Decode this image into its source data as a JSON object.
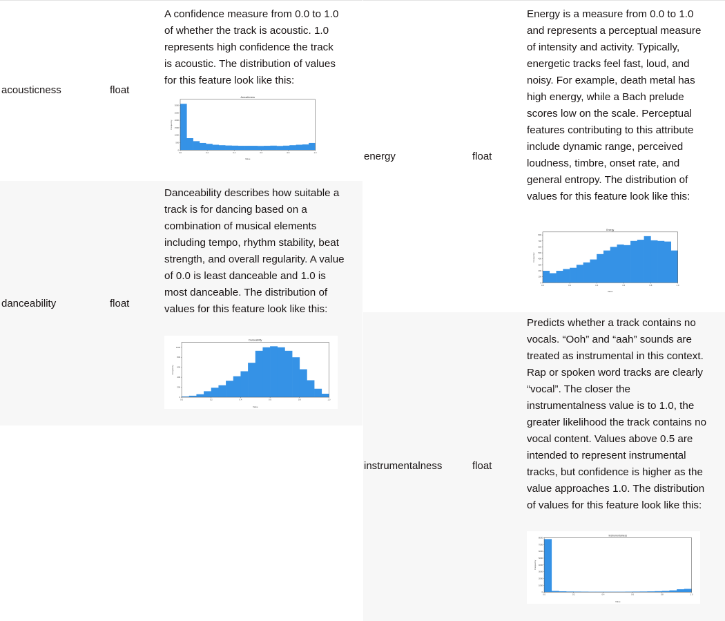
{
  "columns": {
    "left": [
      {
        "name": "acousticness",
        "type": "float",
        "description": "A confidence measure from 0.0 to 1.0 of whether the track is acoustic. 1.0 represents high confidence the track is acoustic. The distribution of values for this feature look like this:"
      },
      {
        "name": "danceability",
        "type": "float",
        "description": "Danceability describes how suitable a track is for dancing based on a combination of musical elements including tempo, rhythm stability, beat strength, and overall regularity. A value of 0.0 is least danceable and 1.0 is most danceable. The distribution of values for this feature look like this:"
      }
    ],
    "right": [
      {
        "name": "energy",
        "type": "float",
        "description": "Energy is a measure from 0.0 to 1.0 and represents a perceptual measure of intensity and activity. Typically, energetic tracks feel fast, loud, and noisy. For example, death metal has high energy, while a Bach prelude scores low on the scale. Perceptual features contributing to this attribute include dynamic range, perceived loudness, timbre, onset rate, and general entropy. The distribution of values for this feature look like this:"
      },
      {
        "name": "instrumentalness",
        "type": "float",
        "description": "Predicts whether a track contains no vocals. “Ooh” and “aah” sounds are treated as instrumental in this context. Rap or spoken word tracks are clearly “vocal”. The closer the instrumentalness value is to 1.0, the greater likelihood the track contains no vocal content. Values above 0.5 are intended to represent instrumental tracks, but confidence is higher as the value approaches 1.0. The distribution of values for this feature look like this:"
      }
    ]
  },
  "colors": {
    "bar": "#3592e6",
    "row_alt": "#f7f7f7",
    "text": "#191414"
  },
  "chart_data": [
    {
      "type": "bar",
      "title": "Acousticness",
      "xlabel": "Value",
      "ylabel": "Frequency",
      "xlim": [
        0,
        1
      ],
      "ylim": [
        0,
        3400
      ],
      "xticks": [
        "0.0",
        "0.2",
        "0.4",
        "0.6",
        "0.8",
        "1.0"
      ],
      "yticks": [
        "0",
        "500",
        "1000",
        "1500",
        "2000",
        "2500",
        "3000"
      ],
      "values": [
        3100,
        800,
        600,
        480,
        420,
        360,
        330,
        310,
        300,
        290,
        290,
        290,
        280,
        290,
        300,
        280,
        300,
        330,
        360,
        380,
        480
      ]
    },
    {
      "type": "bar",
      "title": "Danceability",
      "xlabel": "Value",
      "ylabel": "Frequency",
      "xlim": [
        0,
        1
      ],
      "ylim": [
        0,
        1100
      ],
      "xticks": [
        "0.0",
        "0.2",
        "0.4",
        "0.6",
        "0.8",
        "1.0"
      ],
      "yticks": [
        "0",
        "200",
        "400",
        "600",
        "800",
        "1000"
      ],
      "values": [
        15,
        30,
        60,
        120,
        190,
        240,
        330,
        420,
        520,
        690,
        930,
        1000,
        1020,
        1000,
        930,
        800,
        560,
        340,
        170,
        70
      ]
    },
    {
      "type": "bar",
      "title": "Energy",
      "xlabel": "Value",
      "ylabel": "Frequency",
      "xlim": [
        0,
        1
      ],
      "ylim": [
        0,
        850
      ],
      "xticks": [
        "0.0",
        "0.2",
        "0.4",
        "0.6",
        "0.8",
        "1.0"
      ],
      "yticks": [
        "0",
        "100",
        "200",
        "300",
        "400",
        "500",
        "600",
        "700",
        "800"
      ],
      "values": [
        200,
        160,
        200,
        230,
        250,
        300,
        340,
        390,
        480,
        540,
        600,
        640,
        630,
        700,
        720,
        780,
        710,
        700,
        690,
        540
      ]
    },
    {
      "type": "bar",
      "title": "Instrumentalness",
      "xlabel": "Value",
      "ylabel": "Frequency",
      "xlim": [
        0,
        1
      ],
      "ylim": [
        0,
        8000
      ],
      "xticks": [
        "0.0",
        "0.2",
        "0.4",
        "0.6",
        "0.8",
        "1.0"
      ],
      "yticks": [
        "0",
        "1000",
        "2000",
        "3000",
        "4000",
        "5000",
        "6000",
        "7000",
        "8000"
      ],
      "values": [
        7800,
        180,
        120,
        90,
        80,
        70,
        60,
        60,
        60,
        60,
        60,
        70,
        80,
        90,
        110,
        140,
        180,
        260,
        420,
        480
      ]
    }
  ]
}
